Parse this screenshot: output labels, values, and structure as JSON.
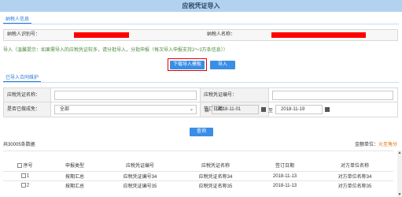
{
  "title": "应税凭证导入",
  "taxpayer_tab": "纳税人信息",
  "taxpayer_id_label": "纳税人识别号：",
  "taxpayer_name_label": "纳税人名称：",
  "notice": "导入（温馨提示：如果需导入的应税凭证较多，请分批导入，分批申报（每次导入申报支持2～3万条信息））",
  "download_btn": "下载导入模板",
  "import_btn": "导入",
  "imported_tab": "已导入合同维护",
  "form": {
    "voucher_name_label": "应税凭证名称：",
    "voucher_no_label": "应税凭证编号：",
    "declared_label": "是否已做成免：",
    "declared_value": "全部",
    "sign_date_label": "签订日期：",
    "from_label": "自",
    "from_date": "2018-11-01",
    "to_label": "至",
    "to_date": "2018-11-19"
  },
  "query_btn": "查询",
  "total_text": "共30005条数据",
  "unit_label": "金额单位：",
  "unit_value": "元至角分",
  "table": {
    "headers": [
      "序号",
      "申报类型",
      "应税凭证编号",
      "应税凭证名称",
      "签订日期",
      "对方单位名称"
    ],
    "rows": [
      {
        "no": "1",
        "type": "按期汇总",
        "code": "应税凭证编号34",
        "name": "应税凭证名称34",
        "date": "2018-11-13",
        "party": "对方单位名称34"
      },
      {
        "no": "2",
        "type": "按期汇总",
        "code": "应税凭证编号35",
        "name": "应税凭证名称35",
        "date": "2018-11-13",
        "party": "对方单位名称35"
      }
    ]
  }
}
